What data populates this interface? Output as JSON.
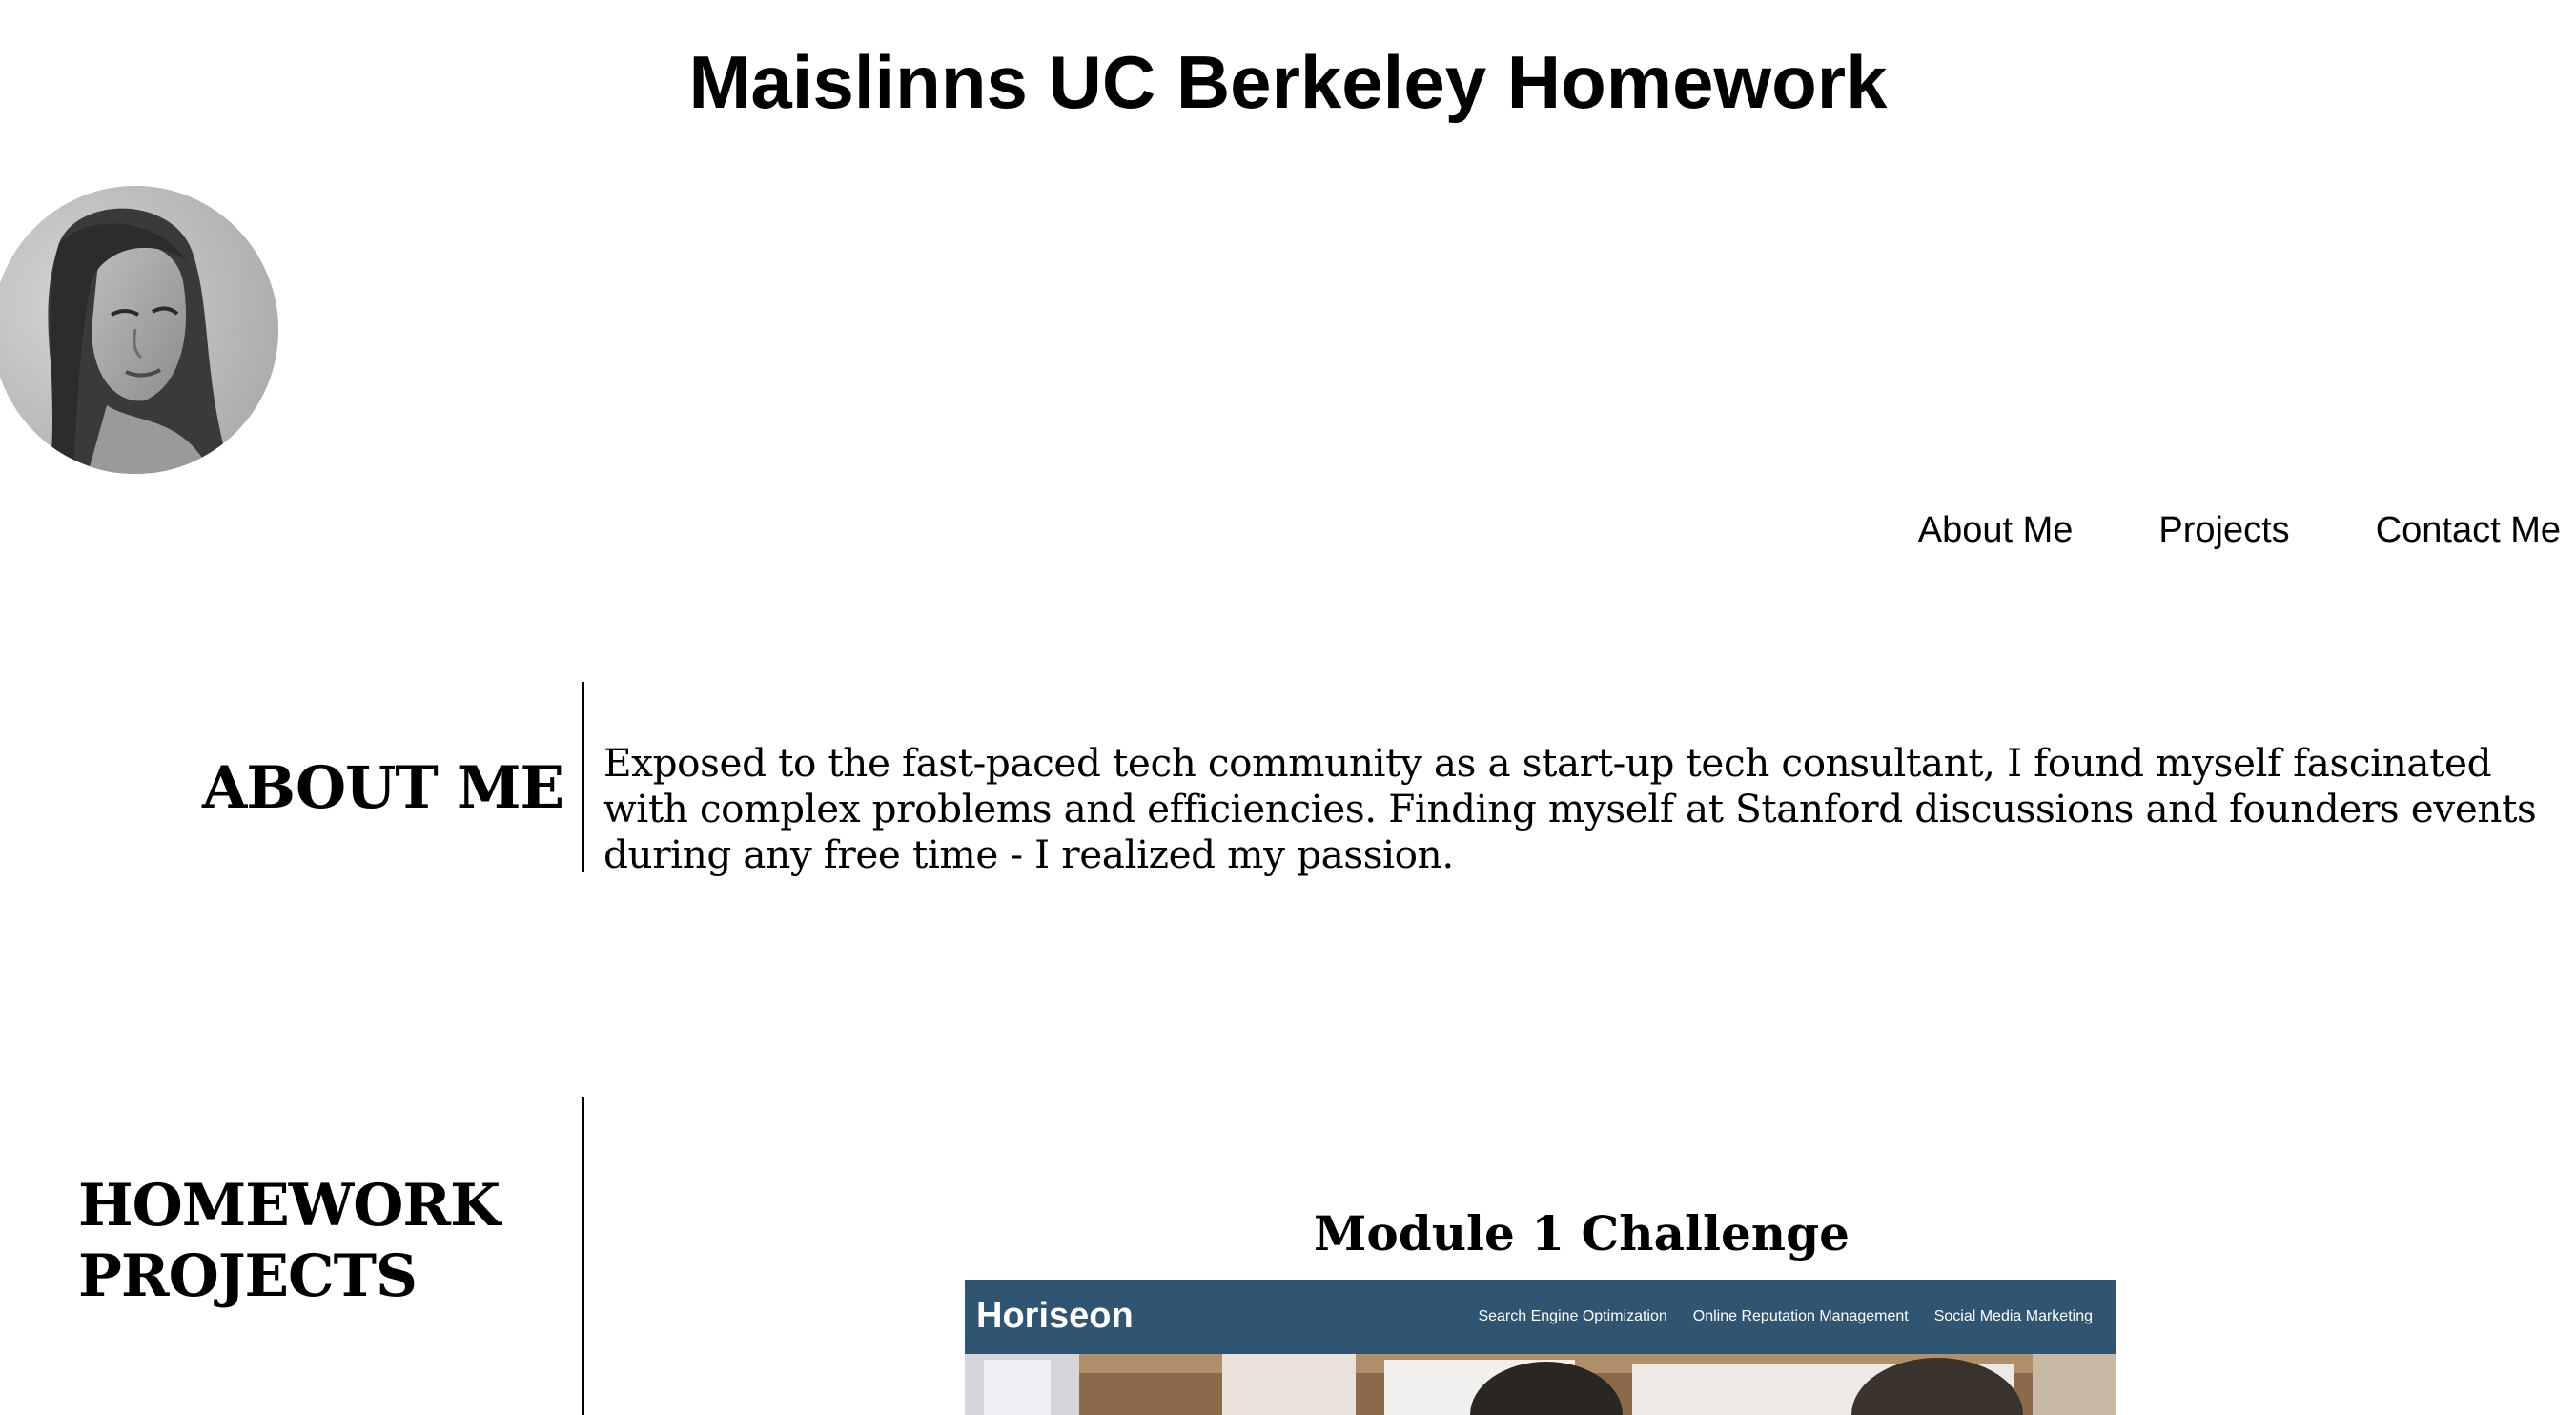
{
  "header": {
    "title": "Maislinns UC Berkeley Homework"
  },
  "nav": {
    "items": [
      {
        "label": "About Me"
      },
      {
        "label": "Projects"
      },
      {
        "label": "Contact Me"
      }
    ]
  },
  "about": {
    "heading": "ABOUT ME",
    "text": "Exposed to the fast-paced tech community as a start-up tech consultant, I found myself fascinated with complex problems and efficiencies. Finding myself at Stanford discussions and founders events during any free time - I realized my passion."
  },
  "projects": {
    "heading": "HOMEWORK PROJECTS",
    "items": [
      {
        "title": "Module 1 Challenge",
        "preview": {
          "logo": "Horiseon",
          "nav": [
            "Search Engine Optimization",
            "Online Reputation Management",
            "Social Media Marketing"
          ]
        }
      }
    ]
  },
  "colors": {
    "preview_header": "#2f5573",
    "text": "#000000",
    "background": "#ffffff"
  }
}
